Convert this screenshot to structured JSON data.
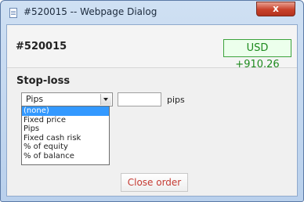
{
  "window": {
    "title": "#520015 -- Webpage Dialog",
    "close_label": "x"
  },
  "order": {
    "id": "#520015",
    "profit": "USD +910.26"
  },
  "stop_loss": {
    "title": "Stop-loss",
    "selected": "Pips",
    "value": "",
    "unit": "pips",
    "options": [
      "(none)",
      "Fixed price",
      "Pips",
      "Fixed cash risk",
      "% of equity",
      "% of balance"
    ],
    "highlighted_option": "(none)"
  },
  "footer": {
    "close_order_label": "Close order"
  },
  "colors": {
    "profit_green": "#1e8a1e",
    "close_order_red": "#c43a32",
    "highlight_blue": "#3399ff"
  }
}
